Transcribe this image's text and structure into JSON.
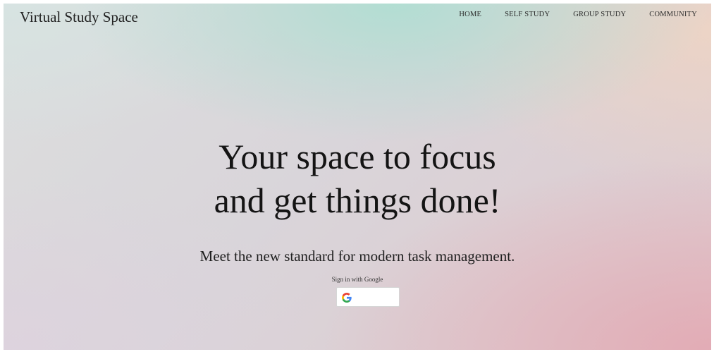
{
  "header": {
    "brand": "Virtual Study Space",
    "nav": [
      "HOME",
      "SELF STUDY",
      "GROUP STUDY",
      "COMMUNITY"
    ]
  },
  "hero": {
    "headline_line1": "Your space to focus",
    "headline_line2": "and get things done!",
    "tagline": "Meet the new standard for modern task management."
  },
  "signin": {
    "label": "Sign in with Google",
    "button_icon": "google-g-icon"
  },
  "colors": {
    "google_blue": "#4285F4",
    "google_red": "#EA4335",
    "google_yellow": "#FBBC05",
    "google_green": "#34A853"
  }
}
